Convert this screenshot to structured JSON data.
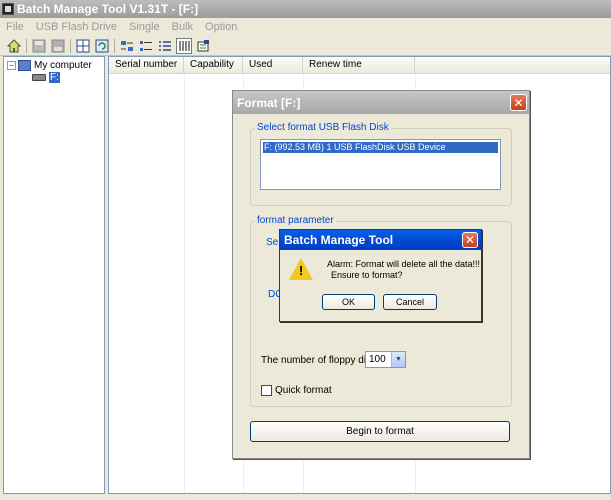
{
  "main_window": {
    "title": "Batch Manage Tool V1.31T  - [F:]"
  },
  "menubar": {
    "items": [
      "File",
      "USB Flash Drive",
      "Single",
      "Bulk",
      "Option"
    ]
  },
  "tree": {
    "root": "My computer",
    "drive": "F:"
  },
  "list_view": {
    "columns": [
      "Serial number",
      "Capability",
      "Used",
      "Renew time"
    ]
  },
  "format_dialog": {
    "title": "Format [F:]",
    "select_group_label": "Select format USB Flash Disk",
    "device_item": "F: (992.53 MB) 1 USB FlashDisk USB Device",
    "param_group_label": "format parameter",
    "partial_se": "Se",
    "partial_do": "DO",
    "floppy_label": "The number of floppy disk",
    "floppy_value": "100",
    "quick_format_label": "Quick format",
    "begin_button": "Begin to format"
  },
  "alarm_dialog": {
    "title": "Batch Manage Tool",
    "message_line1": "Alarm: Format will delete all the data!!!",
    "message_line2": "Ensure to format?",
    "ok_label": "OK",
    "cancel_label": "Cancel"
  },
  "icons": {
    "warning": "!"
  },
  "colors": {
    "selection": "#316ac5",
    "alarm_title": "#0047cf",
    "group_title": "#0046d5"
  }
}
